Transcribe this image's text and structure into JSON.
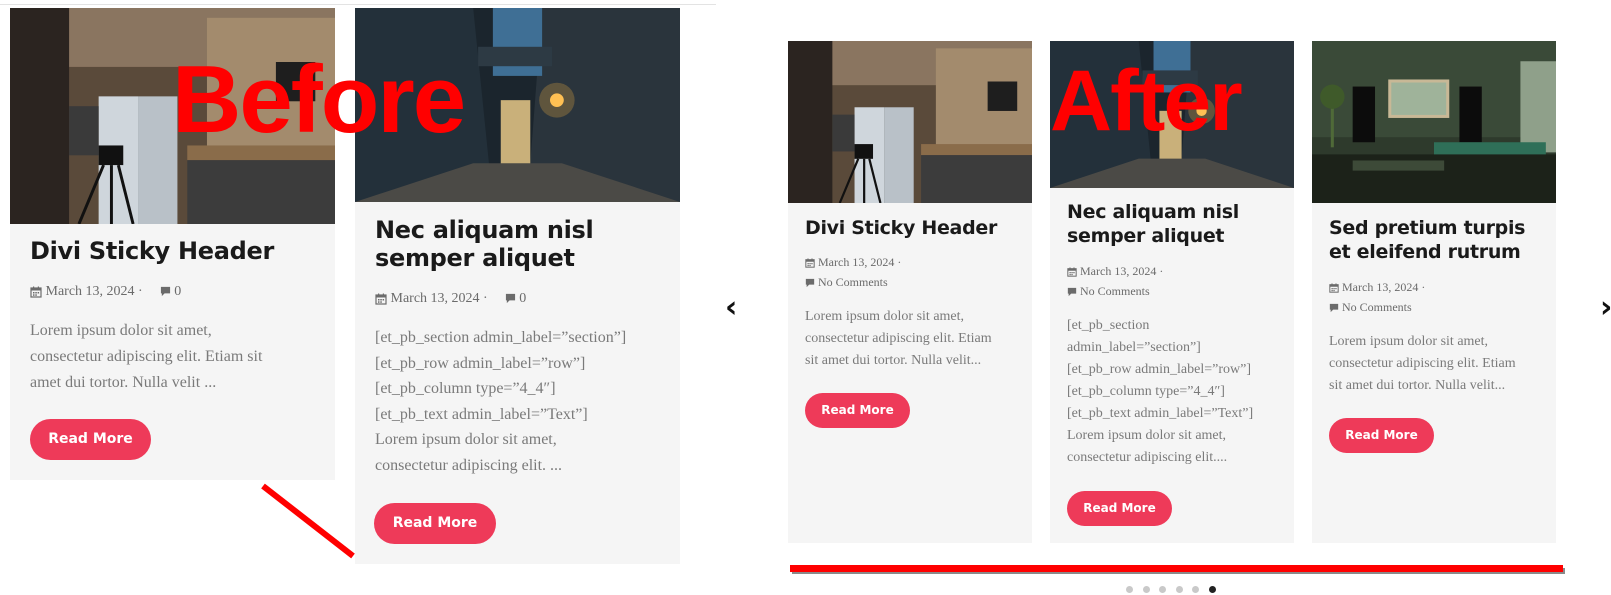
{
  "before_label": "Before",
  "after_label": "After",
  "colors": {
    "accent": "#ee3a59",
    "annotation": "#ff0000",
    "card_bg": "#f5f5f5"
  },
  "before": {
    "card1": {
      "title": "Divi Sticky Header",
      "date": "March 13, 2024",
      "sep": "·",
      "comments": "0",
      "excerpt": [
        "Lorem ipsum dolor sit amet,",
        "consectetur adipiscing elit. Etiam sit",
        "amet dui tortor. Nulla velit ..."
      ],
      "button": "Read More"
    },
    "card2": {
      "title_lines": [
        "Nec aliquam nisl",
        "semper aliquet"
      ],
      "date": "March 13, 2024",
      "sep": "·",
      "comments": "0",
      "excerpt": [
        "[et_pb_section admin_label=”section”]",
        "[et_pb_row admin_label=”row”]",
        "[et_pb_column type=”4_4″]",
        "[et_pb_text admin_label=”Text”]",
        "Lorem ipsum dolor sit amet,",
        "consectetur adipiscing elit. ..."
      ],
      "button": "Read More"
    }
  },
  "after": {
    "prev_arrow": "‹",
    "next_arrow": "›",
    "card1": {
      "title": "Divi Sticky Header",
      "date": "March 13, 2024",
      "sep": "·",
      "comments": "No Comments",
      "excerpt": [
        "Lorem ipsum dolor sit amet,",
        "consectetur adipiscing elit. Etiam",
        "sit amet dui tortor. Nulla velit..."
      ],
      "button": "Read More"
    },
    "card2": {
      "title_lines": [
        "Nec aliquam nisl",
        "semper aliquet"
      ],
      "date": "March 13, 2024",
      "sep": "·",
      "comments": "No Comments",
      "excerpt": [
        "[et_pb_section",
        "admin_label=”section”]",
        "[et_pb_row admin_label=”row”]",
        "[et_pb_column type=”4_4″]",
        "[et_pb_text admin_label=”Text”]",
        "Lorem ipsum dolor sit amet,",
        "consectetur adipiscing elit...."
      ],
      "button": "Read More"
    },
    "card3": {
      "title_lines": [
        "Sed pretium turpis",
        "et eleifend rutrum"
      ],
      "date": "March 13, 2024",
      "sep": "·",
      "comments": "No Comments",
      "excerpt": [
        "Lorem ipsum dolor sit amet,",
        "consectetur adipiscing elit. Etiam",
        "sit amet dui tortor. Nulla velit..."
      ],
      "button": "Read More"
    },
    "pagination": {
      "count": 6,
      "active_index": 5
    }
  }
}
